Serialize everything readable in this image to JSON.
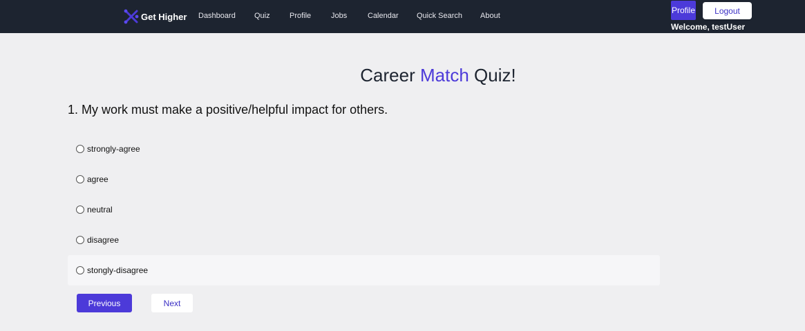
{
  "brand": {
    "name": "Get Higher",
    "logo_icon": "x-logo-icon",
    "logo_color": "#4c3ad9"
  },
  "nav": {
    "items": [
      "Dashboard",
      "Quiz",
      "Profile",
      "Jobs",
      "Calendar",
      "Quick Search",
      "About"
    ]
  },
  "header": {
    "profile_label": "Profile",
    "logout_label": "Logout",
    "welcome_text": "Welcome, testUser"
  },
  "quiz": {
    "title_part1": "Career ",
    "title_accent": "Match",
    "title_part2": " Quiz!",
    "question": "1. My work must make a positive/helpful impact for others.",
    "options": [
      "strongly-agree",
      "agree",
      "neutral",
      "disagree",
      "stongly-disagree"
    ],
    "previous_label": "Previous",
    "next_label": "Next"
  },
  "colors": {
    "navbar_bg": "#1d2430",
    "accent": "#4c3ad9",
    "page_bg": "#efeff1"
  }
}
